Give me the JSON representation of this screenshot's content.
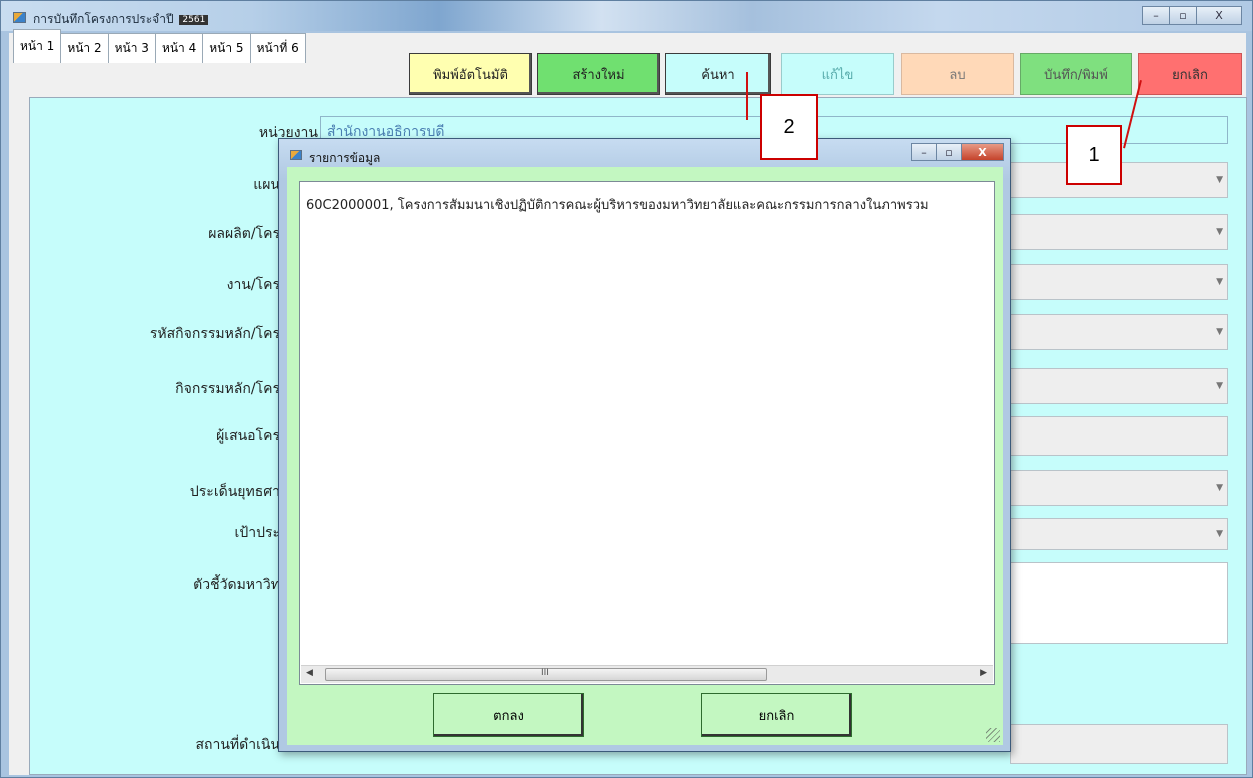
{
  "window": {
    "title": "การบันทึกโครงการประจำปี",
    "year_badge": "2561",
    "controls": {
      "minimize": "–",
      "maximize": "▫",
      "close": "X"
    }
  },
  "tabs": [
    "หน้า 1",
    "หน้า 2",
    "หน้า 3",
    "หน้า 4",
    "หน้า 5",
    "หน้าที่ 6"
  ],
  "toolbar": {
    "auto_print": "พิมพ์อัตโนมัติ",
    "create_new": "สร้างใหม่",
    "search": "ค้นหา",
    "edit": "แก้ไข",
    "delete": "ลบ",
    "save_print": "บันทึก/พิมพ์",
    "cancel": "ยกเลิก",
    "colors": {
      "auto_print": "#ffffb0",
      "create_new": "#70e070",
      "search": "#c6fdfb",
      "edit": "#c6fdfb",
      "delete": "#ffd9b8",
      "save_print": "#7fe07f",
      "cancel": "#ff7070"
    }
  },
  "form": {
    "unit_label": "หน่วยงาน",
    "unit_value": "สำนักงานอธิการบดี",
    "labels": {
      "plan": "แผน",
      "output": "ผลผลิต/โคร",
      "work": "งาน/โคร",
      "activity_code": "รหัสกิจกรรมหลัก/โคร",
      "main_activity": "กิจกรรมหลัก/โคร",
      "proposer": "ผู้เสนอโคร",
      "strategic_issue": "ประเด็นยุทธศา",
      "target": "เป้าประ",
      "indicator": "ตัวชี้วัดมหาวิท",
      "location": "สถานที่ดำเนิน"
    }
  },
  "dialog": {
    "title": "รายการข้อมูล",
    "list_items": [
      "60C2000001, โครงการสัมมนาเชิงปฏิบัติการคณะผู้บริหารของมหาวิทยาลัยและคณะกรรมการกลางในภาพรวม"
    ],
    "ok_label": "ตกลง",
    "cancel_label": "ยกเลิก",
    "scroll_grip": "III"
  },
  "annotations": {
    "callout_1": "1",
    "callout_2": "2"
  }
}
